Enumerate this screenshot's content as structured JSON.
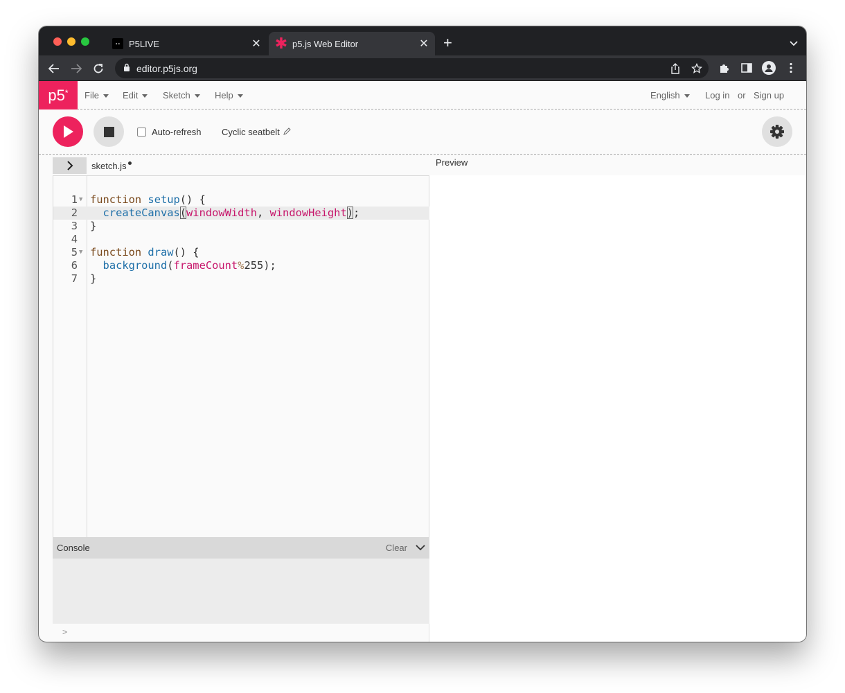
{
  "browser": {
    "tabs": [
      {
        "title": "P5LIVE",
        "favicon": "p5live-icon",
        "active": false
      },
      {
        "title": "p5.js Web Editor",
        "favicon": "p5-asterisk-icon",
        "active": true
      }
    ],
    "url": "editor.p5js.org"
  },
  "header": {
    "logo": "p5",
    "logo_sup": "*",
    "menus": [
      "File",
      "Edit",
      "Sketch",
      "Help"
    ],
    "language": "English",
    "login": "Log in",
    "or": "or",
    "signup": "Sign up"
  },
  "toolbar": {
    "autorefresh_label": "Auto-refresh",
    "autorefresh_checked": false,
    "sketch_name": "Cyclic seatbelt"
  },
  "editor": {
    "filename": "sketch.js",
    "preview_label": "Preview",
    "active_line": 2,
    "lines": [
      {
        "num": "1",
        "fold": true
      },
      {
        "num": "2",
        "fold": false
      },
      {
        "num": "3",
        "fold": false
      },
      {
        "num": "4",
        "fold": false
      },
      {
        "num": "5",
        "fold": true
      },
      {
        "num": "6",
        "fold": false
      },
      {
        "num": "7",
        "fold": false
      }
    ],
    "code": [
      [
        {
          "t": "function",
          "c": "kw"
        },
        {
          "t": " "
        },
        {
          "t": "setup",
          "c": "fn"
        },
        {
          "t": "() {"
        }
      ],
      [
        {
          "t": "  "
        },
        {
          "t": "createCanvas",
          "c": "fn"
        },
        {
          "t": "(",
          "c": "br"
        },
        {
          "t": "windowWidth",
          "c": "vr"
        },
        {
          "t": ", "
        },
        {
          "t": "windowHeight",
          "c": "vr"
        },
        {
          "t": ")",
          "c": "br"
        },
        {
          "t": ";"
        }
      ],
      [
        {
          "t": "}"
        }
      ],
      [],
      [
        {
          "t": "function",
          "c": "kw"
        },
        {
          "t": " "
        },
        {
          "t": "draw",
          "c": "fn"
        },
        {
          "t": "() {"
        }
      ],
      [
        {
          "t": "  "
        },
        {
          "t": "background",
          "c": "fn"
        },
        {
          "t": "("
        },
        {
          "t": "frameCount",
          "c": "vr"
        },
        {
          "t": "%",
          "c": "op"
        },
        {
          "t": "255);"
        }
      ],
      [
        {
          "t": "}"
        }
      ]
    ]
  },
  "console": {
    "title": "Console",
    "clear_label": "Clear",
    "prompt": ">"
  },
  "colors": {
    "accent": "#ed225d",
    "chrome_dark": "#202124",
    "chrome_toolbar": "#35363a"
  }
}
